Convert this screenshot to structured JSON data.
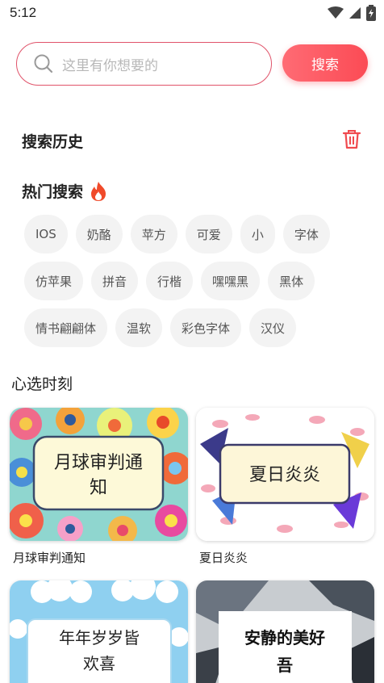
{
  "status": {
    "time": "5:12"
  },
  "search": {
    "placeholder": "这里有你想要的",
    "button_label": "搜索"
  },
  "history": {
    "title": "搜索历史"
  },
  "hot": {
    "title": "热门搜索",
    "tags": [
      [
        "IOS",
        "奶酪",
        "苹方",
        "可爱",
        "小",
        "字体"
      ],
      [
        "仿苹果",
        "拼音",
        "行楷",
        "嘿嘿黑",
        "黑体"
      ],
      [
        "情书翩翩体",
        "温软",
        "彩色字体",
        "汉仪"
      ]
    ]
  },
  "featured": {
    "title": "心选时刻",
    "cards": [
      {
        "caption": "月球审判通知",
        "image_text": [
          "月球审判通",
          "知"
        ]
      },
      {
        "caption": "夏日炎炎",
        "image_text": [
          "夏日炎炎"
        ]
      },
      {
        "image_text": [
          "年年岁岁皆",
          "欢喜"
        ]
      },
      {
        "image_text": [
          "安静的美好",
          "吾"
        ]
      }
    ]
  },
  "colors": {
    "accent": "#fb4b55",
    "tag_bg": "#f3f3f3"
  }
}
